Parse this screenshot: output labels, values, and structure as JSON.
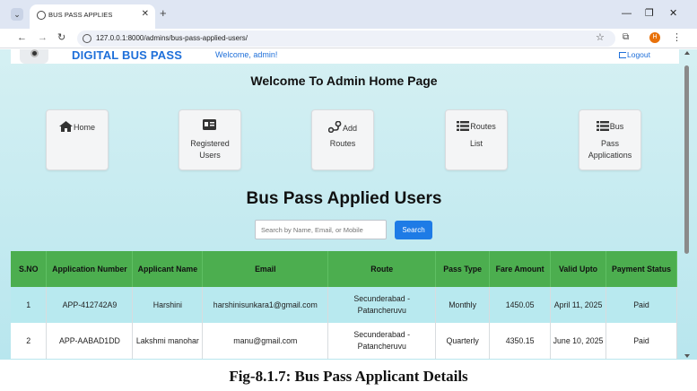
{
  "browser": {
    "tab_title": "BUS PASS APPLIES",
    "tab_close": "✕",
    "new_tab": "+",
    "minimize": "—",
    "restore": "❐",
    "close": "✕",
    "back": "←",
    "forward": "→",
    "reload": "↻",
    "url": "127.0.0.1:8000/admins/bus-pass-applied-users/",
    "star": "☆",
    "extensions": "⧉",
    "profile_initial": "H",
    "menu": "⋮",
    "tab_menu": "⌄"
  },
  "navbar": {
    "brand": "DIGITAL BUS PASS",
    "welcome": "Welcome, admin!",
    "logout": "Logout"
  },
  "admin_title": "Welcome To Admin Home Page",
  "cards": [
    {
      "icon": "home-icon",
      "line1": "Home",
      "line2": "",
      "line3": ""
    },
    {
      "icon": "id-card-icon",
      "line1": "",
      "line2": "Registered",
      "line3": "Users"
    },
    {
      "icon": "route-icon",
      "line1": "Add",
      "line2": "Routes",
      "line3": ""
    },
    {
      "icon": "list-icon",
      "line1": "Routes",
      "line2": "List",
      "line3": ""
    },
    {
      "icon": "list-icon",
      "line1": "Bus",
      "line2": "Pass",
      "line3": "Applications"
    }
  ],
  "applied_title": "Bus Pass Applied Users",
  "search": {
    "placeholder": "Search by Name, Email, or Mobile",
    "button": "Search"
  },
  "table": {
    "headers": [
      "S.NO",
      "Application Number",
      "Applicant Name",
      "Email",
      "Route",
      "Pass Type",
      "Fare Amount",
      "Valid Upto",
      "Payment Status"
    ],
    "rows": [
      [
        "1",
        "APP-412742A9",
        "Harshini",
        "harshinisunkara1@gmail.com",
        "Secunderabad - Patancheruvu",
        "Monthly",
        "1450.05",
        "April 11, 2025",
        "Paid"
      ],
      [
        "2",
        "APP-AABAD1DD",
        "Lakshmi manohar",
        "manu@gmail.com",
        "Secunderabad - Patancheruvu",
        "Quarterly",
        "4350.15",
        "June 10, 2025",
        "Paid"
      ]
    ]
  },
  "caption": "Fig-8.1.7: Bus Pass Applicant Details",
  "colors": {
    "accent": "#1e6fd9",
    "table_header": "#4cae4f",
    "row_highlight": "#b8e9ef",
    "search_button": "#1e7be6"
  }
}
